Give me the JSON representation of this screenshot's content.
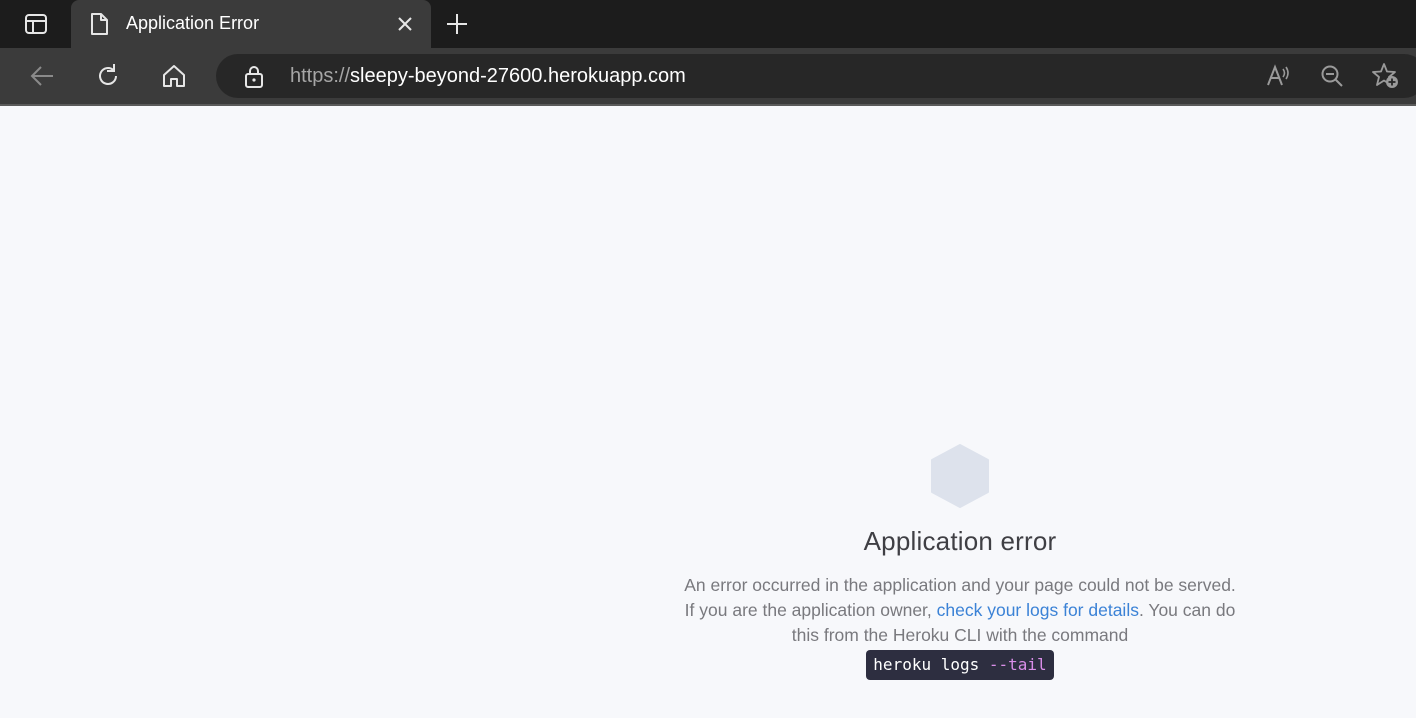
{
  "browser": {
    "tab": {
      "title": "Application Error"
    },
    "address_bar": {
      "url_scheme": "https://",
      "url_host": "sleepy-beyond-27600.herokuapp.com"
    },
    "icons": {
      "tab_actions": "tab-actions-icon",
      "page": "page-icon",
      "close": "close-icon",
      "new_tab": "plus-icon",
      "back": "back-arrow-icon",
      "refresh": "refresh-icon",
      "home": "home-icon",
      "lock": "lock-icon",
      "read_aloud": "read-aloud-icon",
      "zoom_out": "zoom-out-icon",
      "favorites": "add-favorite-icon"
    },
    "colors": {
      "tabstrip": "#1c1c1c",
      "toolbar": "#3b3b3b",
      "omnibox": "#272727"
    }
  },
  "page": {
    "heading": "Application error",
    "message_part1": "An error occurred in the application and your page could not be served. If you are the application owner, ",
    "link_text": "check your logs for details",
    "message_part2": ". You can do this from the Heroku CLI with the command",
    "command_base": "heroku logs ",
    "command_flag": "--tail",
    "colors": {
      "background": "#f7f8fb",
      "hexagon": "#dde2ec",
      "link": "#3b82d6",
      "command_bg": "#2d2e40",
      "command_flag": "#d98ee8"
    }
  }
}
